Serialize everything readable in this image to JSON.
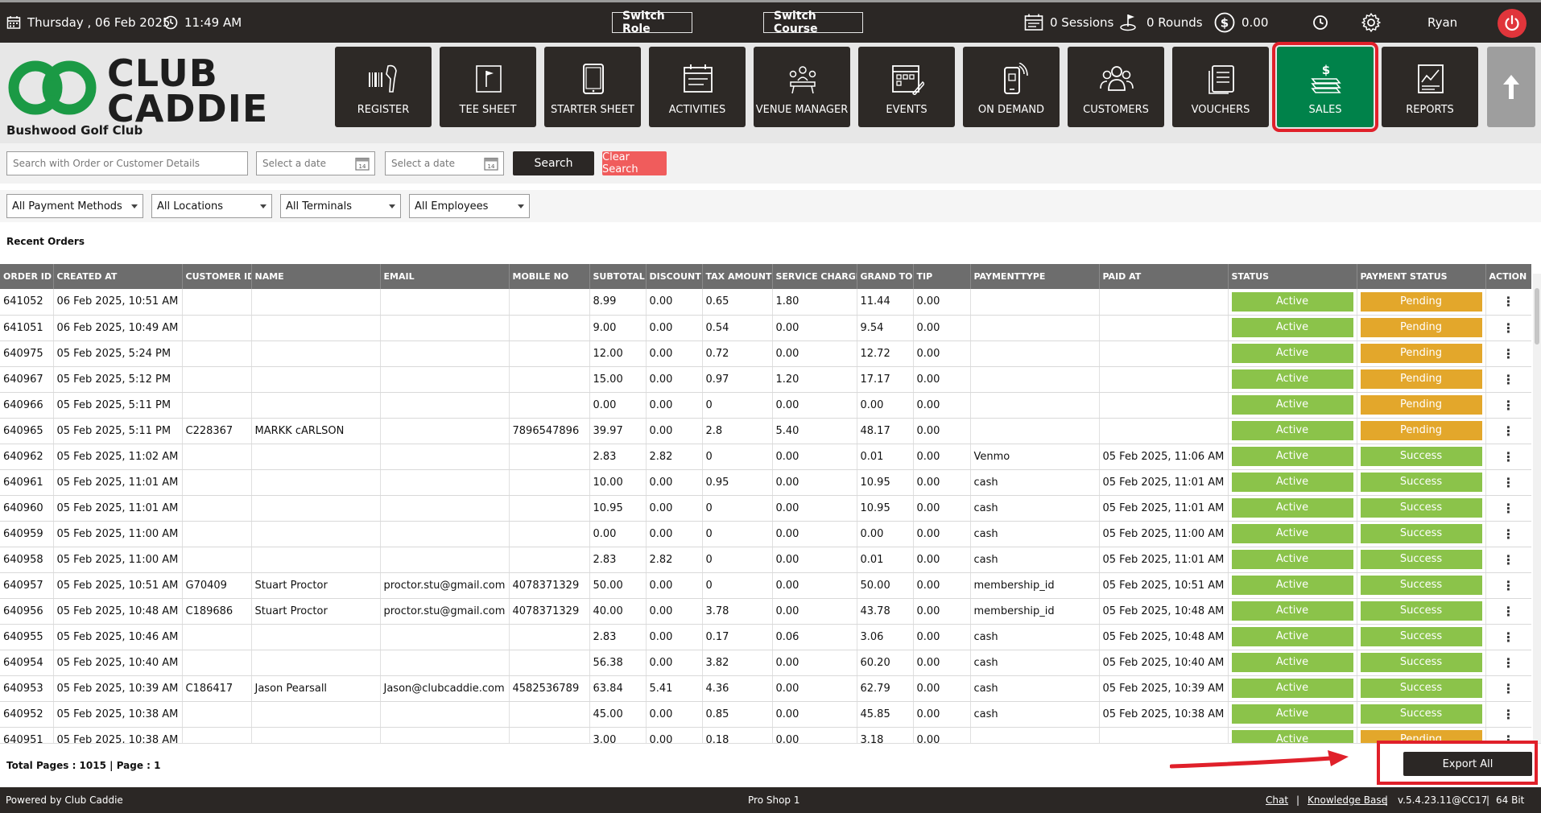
{
  "topbar": {
    "date": "Thursday ,  06 Feb 2025",
    "time": "11:49 AM",
    "switch_role": "Switch Role",
    "switch_course": "Switch Course",
    "sessions": "0 Sessions",
    "rounds": "0 Rounds",
    "balance": "0.00",
    "user": "Ryan"
  },
  "brand": {
    "logo_line1": "CLUB",
    "logo_line2": "CADDIE",
    "club_name": "Bushwood Golf Club",
    "logo_green": "#1b9a45"
  },
  "nav": [
    {
      "label": "REGISTER",
      "icon": "barcode-scanner-icon"
    },
    {
      "label": "TEE SHEET",
      "icon": "flag-icon"
    },
    {
      "label": "STARTER SHEET",
      "icon": "tablet-icon"
    },
    {
      "label": "ACTIVITIES",
      "icon": "calendar-icon"
    },
    {
      "label": "VENUE MANAGER",
      "icon": "meeting-icon"
    },
    {
      "label": "EVENTS",
      "icon": "event-calendar-icon"
    },
    {
      "label": "ON DEMAND",
      "icon": "mobile-icon"
    },
    {
      "label": "CUSTOMERS",
      "icon": "users-icon"
    },
    {
      "label": "VOUCHERS",
      "icon": "vouchers-icon"
    },
    {
      "label": "SALES",
      "icon": "money-icon",
      "active": true
    },
    {
      "label": "REPORTS",
      "icon": "report-icon"
    }
  ],
  "search": {
    "placeholder": "Search with Order or Customer Details",
    "date_from_placeholder": "Select a date",
    "date_to_placeholder": "Select a date",
    "search_label": "Search",
    "clear_label": "Clear Search"
  },
  "filters": {
    "payment_methods": "All Payment Methods",
    "locations": "All Locations",
    "terminals": "All Terminals",
    "employees": "All Employees"
  },
  "section_title": "Recent Orders",
  "table": {
    "columns": [
      "ORDER ID",
      "CREATED AT",
      "CUSTOMER ID",
      "NAME",
      "EMAIL",
      "MOBILE NO",
      "SUBTOTAL",
      "DISCOUNT",
      "TAX AMOUNT",
      "SERVICE CHARGE",
      "GRAND TO",
      "TIP",
      "PAYMENTTYPE",
      "PAID AT",
      "STATUS",
      "PAYMENT STATUS",
      "ACTION"
    ],
    "rows": [
      [
        "641052",
        "06 Feb 2025, 10:51 AM",
        "",
        "",
        "",
        "",
        "8.99",
        "0.00",
        "0.65",
        "1.80",
        "11.44",
        "0.00",
        "",
        "",
        "Active",
        "Pending",
        "⋮"
      ],
      [
        "641051",
        "06 Feb 2025, 10:49 AM",
        "",
        "",
        "",
        "",
        "9.00",
        "0.00",
        "0.54",
        "0.00",
        "9.54",
        "0.00",
        "",
        "",
        "Active",
        "Pending",
        "⋮"
      ],
      [
        "640975",
        "05 Feb 2025, 5:24 PM",
        "",
        "",
        "",
        "",
        "12.00",
        "0.00",
        "0.72",
        "0.00",
        "12.72",
        "0.00",
        "",
        "",
        "Active",
        "Pending",
        "⋮"
      ],
      [
        "640967",
        "05 Feb 2025, 5:12 PM",
        "",
        "",
        "",
        "",
        "15.00",
        "0.00",
        "0.97",
        "1.20",
        "17.17",
        "0.00",
        "",
        "",
        "Active",
        "Pending",
        "⋮"
      ],
      [
        "640966",
        "05 Feb 2025, 5:11 PM",
        "",
        "",
        "",
        "",
        "0.00",
        "0.00",
        "0",
        "0.00",
        "0.00",
        "0.00",
        "",
        "",
        "Active",
        "Pending",
        "⋮"
      ],
      [
        "640965",
        "05 Feb 2025, 5:11 PM",
        "C228367",
        "MARKK cARLSON",
        "",
        "7896547896",
        "39.97",
        "0.00",
        "2.8",
        "5.40",
        "48.17",
        "0.00",
        "",
        "",
        "Active",
        "Pending",
        "⋮"
      ],
      [
        "640962",
        "05 Feb 2025, 11:02 AM",
        "",
        "",
        "",
        "",
        "2.83",
        "2.82",
        "0",
        "0.00",
        "0.01",
        "0.00",
        "Venmo",
        "05 Feb 2025, 11:06 AM",
        "Active",
        "Success",
        "⋮"
      ],
      [
        "640961",
        "05 Feb 2025, 11:01 AM",
        "",
        "",
        "",
        "",
        "10.00",
        "0.00",
        "0.95",
        "0.00",
        "10.95",
        "0.00",
        "cash",
        "05 Feb 2025, 11:01 AM",
        "Active",
        "Success",
        "⋮"
      ],
      [
        "640960",
        "05 Feb 2025, 11:01 AM",
        "",
        "",
        "",
        "",
        "10.95",
        "0.00",
        "0",
        "0.00",
        "10.95",
        "0.00",
        "cash",
        "05 Feb 2025, 11:01 AM",
        "Active",
        "Success",
        "⋮"
      ],
      [
        "640959",
        "05 Feb 2025, 11:00 AM",
        "",
        "",
        "",
        "",
        "0.00",
        "0.00",
        "0",
        "0.00",
        "0.00",
        "0.00",
        "cash",
        "05 Feb 2025, 11:00 AM",
        "Active",
        "Success",
        "⋮"
      ],
      [
        "640958",
        "05 Feb 2025, 11:00 AM",
        "",
        "",
        "",
        "",
        "2.83",
        "2.82",
        "0",
        "0.00",
        "0.01",
        "0.00",
        "cash",
        "05 Feb 2025, 11:01 AM",
        "Active",
        "Success",
        "⋮"
      ],
      [
        "640957",
        "05 Feb 2025, 10:51 AM",
        "G70409",
        "Stuart Proctor",
        "proctor.stu@gmail.com",
        "4078371329",
        "50.00",
        "0.00",
        "0",
        "0.00",
        "50.00",
        "0.00",
        "membership_id",
        "05 Feb 2025, 10:51 AM",
        "Active",
        "Success",
        "⋮"
      ],
      [
        "640956",
        "05 Feb 2025, 10:48 AM",
        "C189686",
        "Stuart Proctor",
        "proctor.stu@gmail.com",
        "4078371329",
        "40.00",
        "0.00",
        "3.78",
        "0.00",
        "43.78",
        "0.00",
        "membership_id",
        "05 Feb 2025, 10:48 AM",
        "Active",
        "Success",
        "⋮"
      ],
      [
        "640955",
        "05 Feb 2025, 10:46 AM",
        "",
        "",
        "",
        "",
        "2.83",
        "0.00",
        "0.17",
        "0.06",
        "3.06",
        "0.00",
        "cash",
        "05 Feb 2025, 10:48 AM",
        "Active",
        "Success",
        "⋮"
      ],
      [
        "640954",
        "05 Feb 2025, 10:40 AM",
        "",
        "",
        "",
        "",
        "56.38",
        "0.00",
        "3.82",
        "0.00",
        "60.20",
        "0.00",
        "cash",
        "05 Feb 2025, 10:40 AM",
        "Active",
        "Success",
        "⋮"
      ],
      [
        "640953",
        "05 Feb 2025, 10:39 AM",
        "C186417",
        "Jason Pearsall",
        "Jason@clubcaddie.com",
        "4582536789",
        "63.84",
        "5.41",
        "4.36",
        "0.00",
        "62.79",
        "0.00",
        "cash",
        "05 Feb 2025, 10:39 AM",
        "Active",
        "Success",
        "⋮"
      ],
      [
        "640952",
        "05 Feb 2025, 10:38 AM",
        "",
        "",
        "",
        "",
        "45.00",
        "0.00",
        "0.85",
        "0.00",
        "45.85",
        "0.00",
        "cash",
        "05 Feb 2025, 10:38 AM",
        "Active",
        "Success",
        "⋮"
      ],
      [
        "640951",
        "05 Feb 2025, 10:38 AM",
        "",
        "",
        "",
        "",
        "3.00",
        "0.00",
        "0.18",
        "0.00",
        "3.18",
        "0.00",
        "",
        "",
        "Active",
        "Pending",
        "⋮"
      ]
    ]
  },
  "footer": {
    "total_pages": "Total Pages : 1015 | Page : 1",
    "export_label": "Export All"
  },
  "statusbar": {
    "powered_by": "Powered by Club Caddie",
    "terminal": "Pro Shop 1",
    "chat": "Chat",
    "separator": "|",
    "knowledge_base": "Knowledge Base",
    "version": "v.5.4.23.11@CC17",
    "bitness": "64 Bit"
  },
  "colors": {
    "dark": "#2b2725",
    "active_green": "#8bc34a",
    "pending_orange": "#e3a72b",
    "sales_green": "#00824a",
    "highlight_red": "#e0202a"
  }
}
